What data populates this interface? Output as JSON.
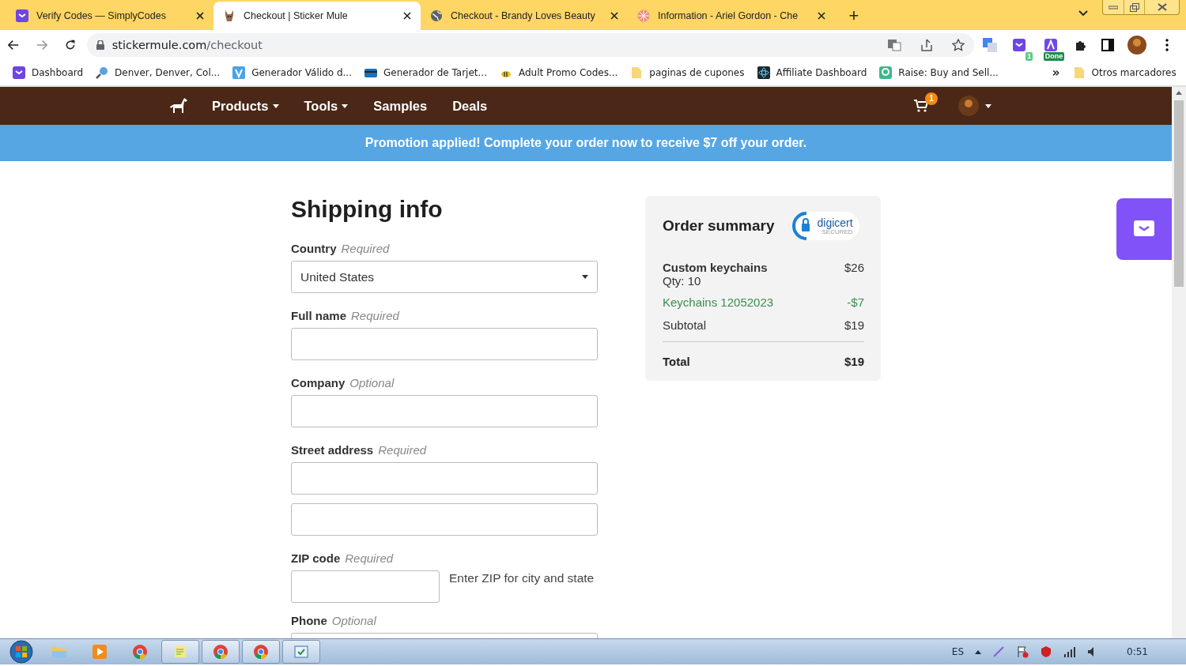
{
  "browser": {
    "tabs": [
      {
        "title": "Verify Codes — SimplyCodes",
        "selected": false
      },
      {
        "title": "Checkout | Sticker Mule",
        "selected": true
      },
      {
        "title": "Checkout - Brandy Loves Beauty",
        "selected": false
      },
      {
        "title": "Information - Ariel Gordon - Che",
        "selected": false
      }
    ],
    "new_tab": "+",
    "url": {
      "host": "stickermule.com",
      "path": "/checkout"
    },
    "extension_badges": [
      "1",
      "Done"
    ],
    "bookmarks": [
      "Dashboard",
      "Denver, Denver, Col...",
      "Generador Válido d...",
      "Generador de Tarjet...",
      "Adult Promo Codes...",
      "paginas de cupones",
      "Affiliate Dashboard",
      "Raise: Buy and Sell..."
    ],
    "bookmarks_more": "»",
    "other_bookmarks": "Otros marcadores"
  },
  "site_nav": {
    "items": [
      {
        "label": "Products",
        "dropdown": true
      },
      {
        "label": "Tools",
        "dropdown": true
      },
      {
        "label": "Samples",
        "dropdown": false
      },
      {
        "label": "Deals",
        "dropdown": false
      }
    ],
    "cart_count": "1"
  },
  "promo_banner": "Promotion applied! Complete your order now to receive $7 off your order.",
  "shipping": {
    "title": "Shipping info",
    "fields": [
      {
        "label": "Country",
        "note": "Required",
        "kind": "select",
        "value": "United States"
      },
      {
        "label": "Full name",
        "note": "Required",
        "kind": "text"
      },
      {
        "label": "Company",
        "note": "Optional",
        "kind": "text"
      },
      {
        "label": "Street address",
        "note": "Required",
        "kind": "address"
      },
      {
        "label": "ZIP code",
        "note": "Required",
        "kind": "zip",
        "hint": "Enter ZIP for city and state"
      },
      {
        "label": "Phone",
        "note": "Optional",
        "kind": "text"
      }
    ]
  },
  "order_summary": {
    "title": "Order summary",
    "seal": {
      "name": "digicert",
      "tagline": "SECURED"
    },
    "lines": [
      {
        "kind": "item",
        "name": "Custom keychains",
        "qty": "Qty: 10",
        "amount": "$26"
      },
      {
        "kind": "discount",
        "name": "Keychains 12052023",
        "amount": "-$7"
      },
      {
        "kind": "subtotal",
        "name": "Subtotal",
        "amount": "$19"
      }
    ],
    "total": {
      "label": "Total",
      "amount": "$19"
    }
  },
  "taskbar": {
    "apps": [
      {
        "active": false
      },
      {
        "active": false
      },
      {
        "active": false
      },
      {
        "active": true
      },
      {
        "active": true
      },
      {
        "active": true
      },
      {
        "active": true
      }
    ],
    "language": "ES",
    "clock": "0:51"
  }
}
